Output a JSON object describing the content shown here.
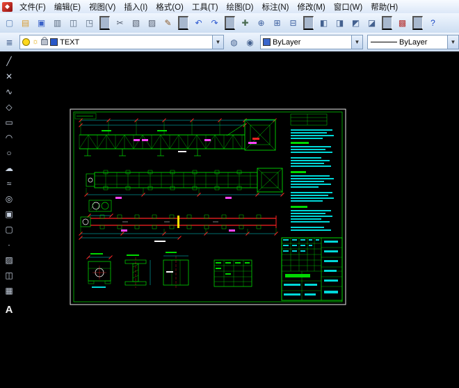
{
  "app": {
    "icon_glyph": "◆"
  },
  "menubar": {
    "items": [
      {
        "name": "menu-file",
        "label": "文件(F)"
      },
      {
        "name": "menu-edit",
        "label": "编辑(E)"
      },
      {
        "name": "menu-view",
        "label": "视图(V)"
      },
      {
        "name": "menu-insert",
        "label": "插入(I)"
      },
      {
        "name": "menu-format",
        "label": "格式(O)"
      },
      {
        "name": "menu-tools",
        "label": "工具(T)"
      },
      {
        "name": "menu-draw",
        "label": "绘图(D)"
      },
      {
        "name": "menu-dimension",
        "label": "标注(N)"
      },
      {
        "name": "menu-modify",
        "label": "修改(M)"
      },
      {
        "name": "menu-window",
        "label": "窗口(W)"
      },
      {
        "name": "menu-help",
        "label": "帮助(H)"
      }
    ]
  },
  "toolbar_standard": {
    "icons": [
      {
        "name": "new-icon",
        "glyph": "▢",
        "color": "#5a7fb4"
      },
      {
        "name": "open-icon",
        "glyph": "▤",
        "color": "#d79b2f"
      },
      {
        "name": "save-icon",
        "glyph": "▣",
        "color": "#3a62c8"
      },
      {
        "name": "plot-icon",
        "glyph": "▥",
        "color": "#5a6b80"
      },
      {
        "name": "plot-preview-icon",
        "glyph": "◫",
        "color": "#5a6b80"
      },
      {
        "name": "publish-icon",
        "glyph": "◳",
        "color": "#5a6b80"
      },
      {
        "name": "separator",
        "sep": true
      },
      {
        "name": "cut-icon",
        "glyph": "✂",
        "color": "#555f70"
      },
      {
        "name": "copy-icon",
        "glyph": "▧",
        "color": "#555f70"
      },
      {
        "name": "paste-icon",
        "glyph": "▨",
        "color": "#555f70"
      },
      {
        "name": "match-properties-icon",
        "glyph": "✎",
        "color": "#8a5a2a"
      },
      {
        "name": "separator",
        "sep": true
      },
      {
        "name": "undo-icon",
        "glyph": "↶",
        "color": "#2b57d0"
      },
      {
        "name": "redo-icon",
        "glyph": "↷",
        "color": "#2b57d0"
      },
      {
        "name": "separator",
        "sep": true
      },
      {
        "name": "pan-icon",
        "glyph": "✚",
        "color": "#4a6b52"
      },
      {
        "name": "zoom-realtime-icon",
        "glyph": "⊕",
        "color": "#3a5d9e"
      },
      {
        "name": "zoom-window-icon",
        "glyph": "⊞",
        "color": "#3a5d9e"
      },
      {
        "name": "zoom-previous-icon",
        "glyph": "⊟",
        "color": "#3a5d9e"
      },
      {
        "name": "separator",
        "sep": true
      },
      {
        "name": "properties-icon",
        "glyph": "◧",
        "color": "#44618f"
      },
      {
        "name": "designcenter-icon",
        "glyph": "◨",
        "color": "#44618f"
      },
      {
        "name": "tool-palettes-icon",
        "glyph": "◩",
        "color": "#44618f"
      },
      {
        "name": "sheetset-icon",
        "glyph": "◪",
        "color": "#44618f"
      },
      {
        "name": "separator",
        "sep": true
      },
      {
        "name": "markup-icon",
        "glyph": "▩",
        "color": "#b43333"
      },
      {
        "name": "separator",
        "sep": true
      },
      {
        "name": "help-icon",
        "glyph": "?",
        "color": "#1b48c4"
      }
    ]
  },
  "layer_toolbar": {
    "layers_button": {
      "name": "layer-manager-icon",
      "glyph": "≣",
      "color": "#44618f"
    },
    "layer_combo": {
      "value": "TEXT",
      "swatch_color": "#2857c8"
    },
    "after_buttons": [
      {
        "name": "layer-states-icon",
        "glyph": "◍",
        "color": "#44618f"
      },
      {
        "name": "make-layer-current-icon",
        "glyph": "◉",
        "color": "#44618f"
      }
    ],
    "color_combo": {
      "value": "ByLayer",
      "swatch_color": "#3a66cc"
    },
    "linetype_combo": {
      "value": "ByLayer"
    }
  },
  "draw_toolbar": {
    "icons": [
      {
        "name": "line-icon",
        "glyph": "╱",
        "color": "#c9d3e2"
      },
      {
        "name": "construction-line-icon",
        "glyph": "✕",
        "color": "#c9d3e2"
      },
      {
        "name": "polyline-icon",
        "glyph": "∿",
        "color": "#c9d3e2"
      },
      {
        "name": "polygon-icon",
        "glyph": "◇",
        "color": "#c9d3e2"
      },
      {
        "name": "rectangle-icon",
        "glyph": "▭",
        "color": "#c9d3e2"
      },
      {
        "name": "arc-icon",
        "glyph": "◠",
        "color": "#c9d3e2"
      },
      {
        "name": "circle-icon",
        "glyph": "○",
        "color": "#c9d3e2"
      },
      {
        "name": "revision-cloud-icon",
        "glyph": "☁",
        "color": "#c9d3e2"
      },
      {
        "name": "spline-icon",
        "glyph": "≈",
        "color": "#c9d3e2"
      },
      {
        "name": "ellipse-icon",
        "glyph": "◎",
        "color": "#c9d3e2"
      },
      {
        "name": "insert-block-icon",
        "glyph": "▣",
        "color": "#c9d3e2"
      },
      {
        "name": "make-block-icon",
        "glyph": "▢",
        "color": "#c9d3e2"
      },
      {
        "name": "point-icon",
        "glyph": "∙",
        "color": "#c9d3e2"
      },
      {
        "name": "hatch-icon",
        "glyph": "▨",
        "color": "#c9d3e2"
      },
      {
        "name": "region-icon",
        "glyph": "◫",
        "color": "#c9d3e2"
      },
      {
        "name": "table-icon",
        "glyph": "▦",
        "color": "#c9d3e2"
      },
      {
        "name": "text-icon",
        "glyph": "A",
        "color": "#f0f0f0"
      }
    ]
  },
  "canvas": {
    "background": "#000000",
    "palette": {
      "frame_white": "#e8e8e8",
      "entity_green": "#00d800",
      "dimension_cyan": "#00d8d8",
      "alert_red": "#ff2222",
      "label_magenta": "#ff44ff",
      "center_yellow": "#ffe000",
      "text_white": "#ffffff"
    }
  }
}
